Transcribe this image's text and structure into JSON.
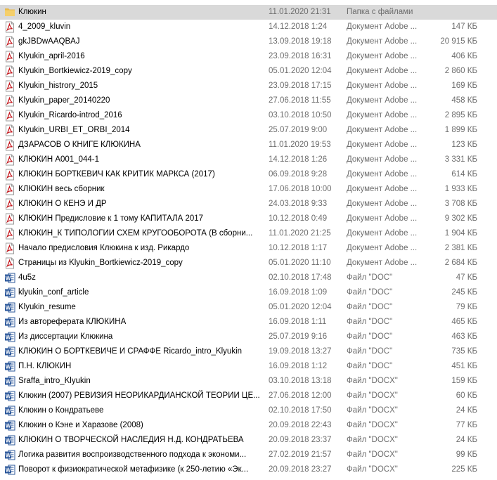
{
  "colors": {
    "selected_row": "#d9d9d9",
    "folder": "#e8b84a",
    "pdf_red": "#c4161c",
    "word_blue": "#2b579a",
    "meta_text": "#6d6d6d"
  },
  "files": [
    {
      "icon": "folder-icon",
      "name": "Клюкин",
      "date": "11.01.2020 21:31",
      "type": "Папка с файлами",
      "size": "",
      "selected": true
    },
    {
      "icon": "pdf-icon",
      "name": "4_2009_kluvin",
      "date": "14.12.2018 1:24",
      "type": "Документ Adobe ...",
      "size": "147 КБ"
    },
    {
      "icon": "pdf-icon",
      "name": "gkJBDwAAQBAJ",
      "date": "13.09.2018 19:18",
      "type": "Документ Adobe ...",
      "size": "20 915 КБ"
    },
    {
      "icon": "pdf-icon",
      "name": "Klyukin_april-2016",
      "date": "23.09.2018 16:31",
      "type": "Документ Adobe ...",
      "size": "406 КБ"
    },
    {
      "icon": "pdf-icon",
      "name": "Klyukin_Bortkiewicz-2019_copy",
      "date": "05.01.2020 12:04",
      "type": "Документ Adobe ...",
      "size": "2 860 КБ"
    },
    {
      "icon": "pdf-icon",
      "name": "Klyukin_histrory_2015",
      "date": "23.09.2018 17:15",
      "type": "Документ Adobe ...",
      "size": "169 КБ"
    },
    {
      "icon": "pdf-icon",
      "name": "Klyukin_paper_20140220",
      "date": "27.06.2018 11:55",
      "type": "Документ Adobe ...",
      "size": "458 КБ"
    },
    {
      "icon": "pdf-icon",
      "name": "Klyukin_Ricardo-introd_2016",
      "date": "03.10.2018 10:50",
      "type": "Документ Adobe ...",
      "size": "2 895 КБ"
    },
    {
      "icon": "pdf-icon",
      "name": "Klyukin_URBI_ET_ORBI_2014",
      "date": "25.07.2019 9:00",
      "type": "Документ Adobe ...",
      "size": "1 899 КБ"
    },
    {
      "icon": "pdf-icon",
      "name": "ДЗАРАСОВ О КНИГЕ КЛЮКИНА",
      "date": "11.01.2020 19:53",
      "type": "Документ Adobe ...",
      "size": "123 КБ"
    },
    {
      "icon": "pdf-icon",
      "name": "КЛЮКИН А001_044-1",
      "date": "14.12.2018 1:26",
      "type": "Документ Adobe ...",
      "size": "3 331 КБ"
    },
    {
      "icon": "pdf-icon",
      "name": "КЛЮКИН БОРТКЕВИЧ КАК КРИТИК МАРКСА (2017)",
      "date": "06.09.2018 9:28",
      "type": "Документ Adobe ...",
      "size": "614 КБ"
    },
    {
      "icon": "pdf-icon",
      "name": "КЛЮКИН весь сборник",
      "date": "17.06.2018 10:00",
      "type": "Документ Adobe ...",
      "size": "1 933 КБ"
    },
    {
      "icon": "pdf-icon",
      "name": "КЛЮКИН О КЕНЭ И ДР",
      "date": "24.03.2018 9:33",
      "type": "Документ Adobe ...",
      "size": "3 708 КБ"
    },
    {
      "icon": "pdf-icon",
      "name": "КЛЮКИН Предисловие к 1 тому КАПИТАЛА 2017",
      "date": "10.12.2018 0:49",
      "type": "Документ Adobe ...",
      "size": "9 302 КБ"
    },
    {
      "icon": "pdf-icon",
      "name": "КЛЮКИН_К ТИПОЛОГИИ СХЕМ КРУГООБОРОТА (В сборни...",
      "date": "11.01.2020 21:25",
      "type": "Документ Adobe ...",
      "size": "1 904 КБ"
    },
    {
      "icon": "pdf-icon",
      "name": "Начало предисловия Клюкина к изд. Рикардо",
      "date": "10.12.2018 1:17",
      "type": "Документ Adobe ...",
      "size": "2 381 КБ"
    },
    {
      "icon": "pdf-icon",
      "name": "Страницы из Klyukin_Bortkiewicz-2019_copy",
      "date": "05.01.2020 11:10",
      "type": "Документ Adobe ...",
      "size": "2 684 КБ"
    },
    {
      "icon": "word-icon",
      "name": "4u5z",
      "date": "02.10.2018 17:48",
      "type": "Файл \"DOC\"",
      "size": "47 КБ"
    },
    {
      "icon": "word-icon",
      "name": "klyukin_conf_article",
      "date": "16.09.2018 1:09",
      "type": "Файл \"DOC\"",
      "size": "245 КБ"
    },
    {
      "icon": "word-icon",
      "name": "Klyukin_resume",
      "date": "05.01.2020 12:04",
      "type": "Файл \"DOC\"",
      "size": "79 КБ"
    },
    {
      "icon": "word-icon",
      "name": "Из автореферата КЛЮКИНА",
      "date": "16.09.2018 1:11",
      "type": "Файл \"DOC\"",
      "size": "465 КБ"
    },
    {
      "icon": "word-icon",
      "name": "Из диссертации Клюкина",
      "date": "25.07.2019 9:16",
      "type": "Файл \"DOC\"",
      "size": "463 КБ"
    },
    {
      "icon": "word-icon",
      "name": "КЛЮКИН О БОРТКЕВИЧЕ И СРАФФЕ Ricardo_intro_Klyukin",
      "date": "19.09.2018 13:27",
      "type": "Файл \"DOC\"",
      "size": "735 КБ"
    },
    {
      "icon": "word-icon",
      "name": "П.Н. КЛЮКИН",
      "date": "16.09.2018 1:12",
      "type": "Файл \"DOC\"",
      "size": "451 КБ"
    },
    {
      "icon": "word-icon",
      "name": "Sraffa_intro_Klyukin",
      "date": "03.10.2018 13:18",
      "type": "Файл \"DOCX\"",
      "size": "159 КБ"
    },
    {
      "icon": "word-icon",
      "name": "Клюкин (2007) РЕВИЗИЯ НЕОРИКАРДИАНСКОЙ ТЕОРИИ ЦЕ...",
      "date": "27.06.2018 12:00",
      "type": "Файл \"DOCX\"",
      "size": "60 КБ"
    },
    {
      "icon": "word-icon",
      "name": "Клюкин о Кондратьеве",
      "date": "02.10.2018 17:50",
      "type": "Файл \"DOCX\"",
      "size": "24 КБ"
    },
    {
      "icon": "word-icon",
      "name": "Клюкин о Кэне и Харазове (2008)",
      "date": "20.09.2018 22:43",
      "type": "Файл \"DOCX\"",
      "size": "77 КБ"
    },
    {
      "icon": "word-icon",
      "name": "КЛЮКИН О ТВОРЧЕСКОЙ НАСЛЕДИЯ Н.Д. КОНДРАТЬЕВА",
      "date": "20.09.2018 23:37",
      "type": "Файл \"DOCX\"",
      "size": "24 КБ"
    },
    {
      "icon": "word-icon",
      "name": "Логика развития воспроизводственного подхода к экономи...",
      "date": "27.02.2019 21:57",
      "type": "Файл \"DOCX\"",
      "size": "99 КБ"
    },
    {
      "icon": "word-icon",
      "name": "Поворот к физиократической метафизике (к 250-летию «Эк...",
      "date": "20.09.2018 23:27",
      "type": "Файл \"DOCX\"",
      "size": "225 КБ"
    }
  ]
}
